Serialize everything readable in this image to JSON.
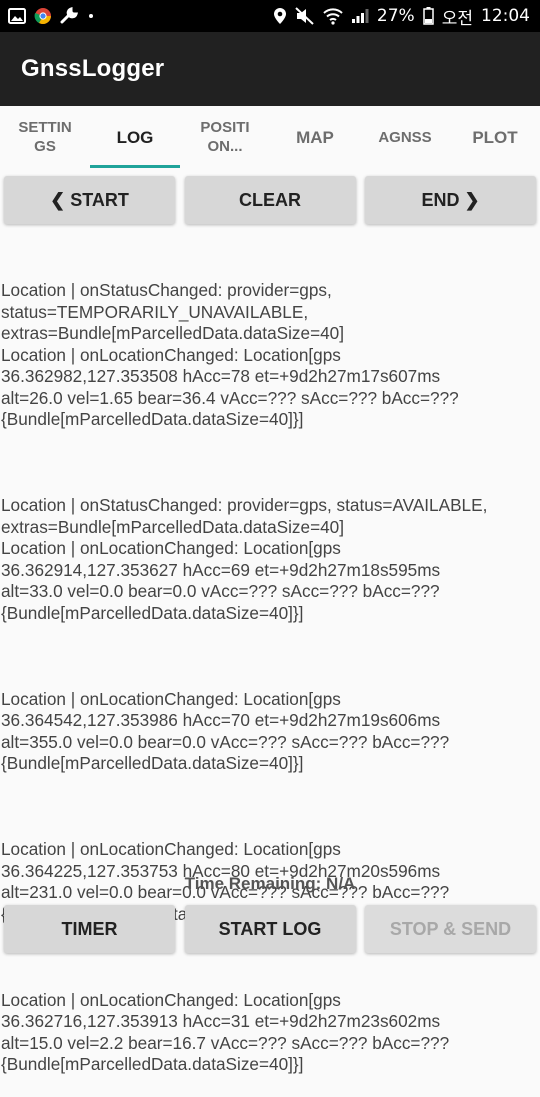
{
  "status_bar": {
    "icons_left": [
      "image-icon",
      "chrome-icon",
      "wrench-icon",
      "dot-icon"
    ],
    "icons_right": [
      "location-pin-icon",
      "mute-icon",
      "wifi-icon",
      "signal-icon",
      "battery-icon"
    ],
    "battery": "27%",
    "ampm": "오전",
    "time": "12:04"
  },
  "app_bar": {
    "title": "GnssLogger"
  },
  "tabs": [
    {
      "label": "SETTIN\nGS"
    },
    {
      "label": "LOG"
    },
    {
      "label": "POSITI\nON..."
    },
    {
      "label": "MAP"
    },
    {
      "label": "AGNSS"
    },
    {
      "label": "PLOT"
    }
  ],
  "active_tab": "LOG",
  "top_buttons": {
    "start": "❮ START",
    "clear": "CLEAR",
    "end": "END ❯"
  },
  "log_entries": [
    "Location | onStatusChanged: provider=gps,\nstatus=TEMPORARILY_UNAVAILABLE,\nextras=Bundle[mParcelledData.dataSize=40]\nLocation | onLocationChanged: Location[gps\n36.362982,127.353508 hAcc=78 et=+9d2h27m17s607ms\nalt=26.0 vel=1.65 bear=36.4 vAcc=??? sAcc=??? bAcc=???\n{Bundle[mParcelledData.dataSize=40]}]",
    "Location | onStatusChanged: provider=gps, status=AVAILABLE,\nextras=Bundle[mParcelledData.dataSize=40]\nLocation | onLocationChanged: Location[gps\n36.362914,127.353627 hAcc=69 et=+9d2h27m18s595ms\nalt=33.0 vel=0.0 bear=0.0 vAcc=??? sAcc=??? bAcc=???\n{Bundle[mParcelledData.dataSize=40]}]",
    "Location | onLocationChanged: Location[gps\n36.364542,127.353986 hAcc=70 et=+9d2h27m19s606ms\nalt=355.0 vel=0.0 bear=0.0 vAcc=??? sAcc=??? bAcc=???\n{Bundle[mParcelledData.dataSize=40]}]",
    "Location | onLocationChanged: Location[gps\n36.364225,127.353753 hAcc=80 et=+9d2h27m20s596ms\nalt=231.0 vel=0.0 bear=0.0 vAcc=??? sAcc=??? bAcc=???\n{Bundle[mParcelledData.dataSize=40]}]",
    "Location | onLocationChanged: Location[gps\n36.362716,127.353913 hAcc=31 et=+9d2h27m23s602ms\nalt=15.0 vel=2.2 bear=16.7 vAcc=??? sAcc=??? bAcc=???\n{Bundle[mParcelledData.dataSize=40]}]"
  ],
  "time_remaining": "Time Remaining: N/A",
  "bottom_buttons": {
    "timer": "TIMER",
    "start_log": "START LOG",
    "stop_send": "STOP & SEND"
  },
  "colors": {
    "accent": "#20a39a",
    "app_bar": "#212121",
    "button": "#d7d7d7"
  }
}
